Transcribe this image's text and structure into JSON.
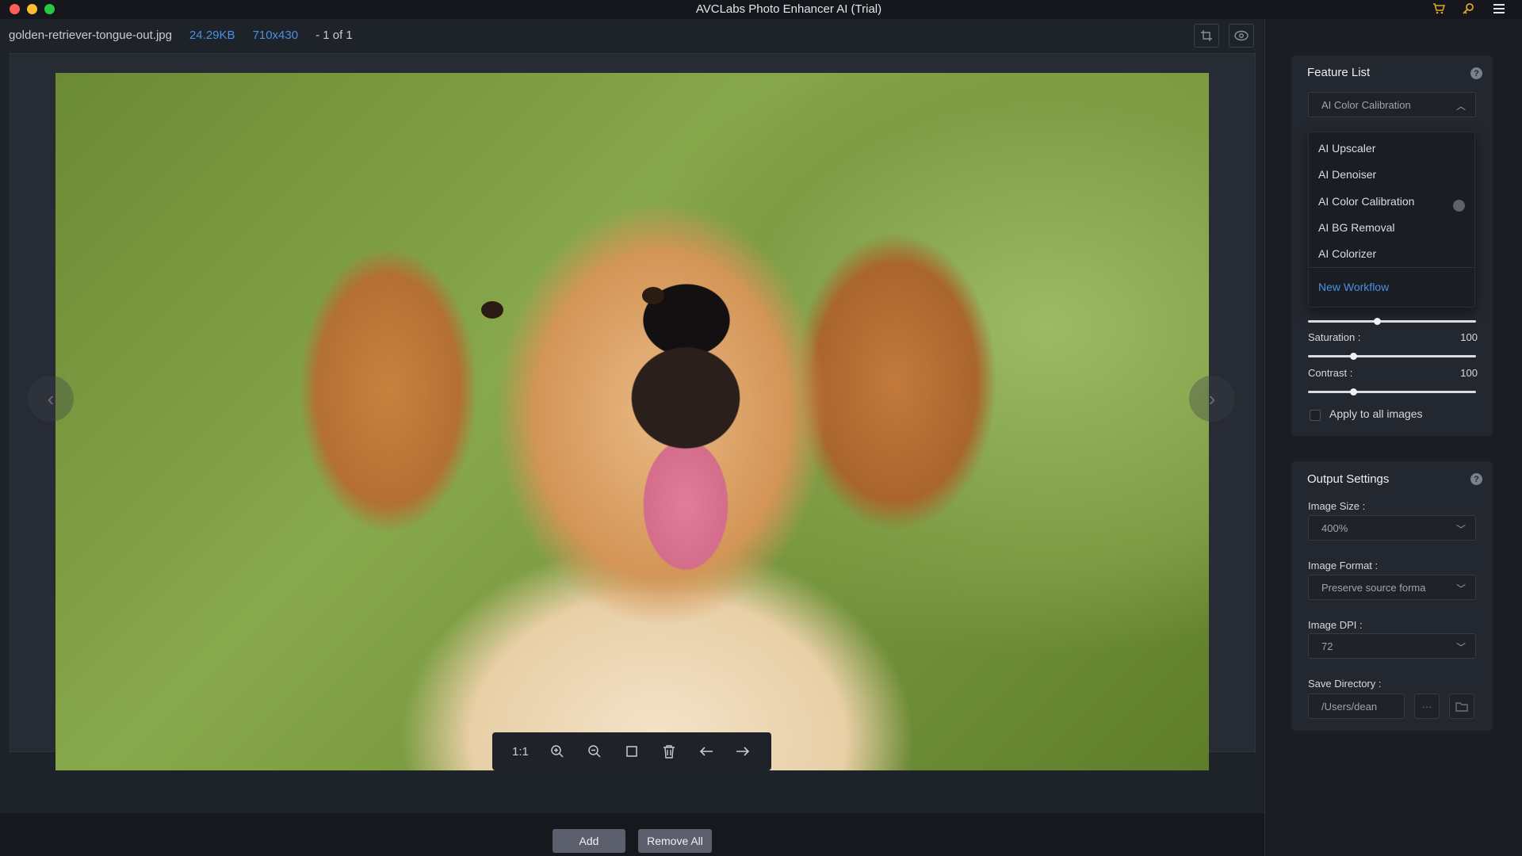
{
  "window": {
    "title": "AVCLabs Photo Enhancer AI (Trial)",
    "cart_icon": "cart-icon",
    "key_icon": "key-icon",
    "menu_icon": "menu-icon"
  },
  "file_info": {
    "name": "golden-retriever-tongue-out.jpg",
    "size": "24.29KB",
    "dimensions": "710x430",
    "count": "- 1 of 1"
  },
  "toolbar": {
    "original_size": "1:1",
    "zoom_in_icon": "zoom-in-icon",
    "zoom_out_icon": "zoom-out-icon",
    "fit_icon": "fit-screen-icon",
    "delete_icon": "trash-icon",
    "prev_icon": "arrow-left-icon",
    "next_icon": "arrow-right-icon"
  },
  "bottom": {
    "add_label": "Add",
    "remove_all_label": "Remove All"
  },
  "feature_list": {
    "title": "Feature List",
    "selected": "AI Color Calibration",
    "options": [
      "AI Upscaler",
      "AI Denoiser",
      "AI Color Calibration",
      "AI BG Removal",
      "AI Colorizer"
    ],
    "new_workflow": "New Workflow"
  },
  "adjustments": {
    "saturation_label": "Saturation :",
    "saturation_value": "100",
    "contrast_label": "Contrast :",
    "contrast_value": "100",
    "apply_all_label": "Apply to all images",
    "apply_all_checked": false,
    "brightness_level": 0.41,
    "saturation_level": 0.27,
    "contrast_level": 0.27
  },
  "output_settings": {
    "title": "Output Settings",
    "image_size_label": "Image Size :",
    "image_size_value": "400%",
    "image_format_label": "Image Format :",
    "image_format_value": "Preserve source forma",
    "image_dpi_label": "Image DPI :",
    "image_dpi_value": "72",
    "save_dir_label": "Save Directory :",
    "save_dir_value": "/Users/dean",
    "more_label": "···"
  }
}
